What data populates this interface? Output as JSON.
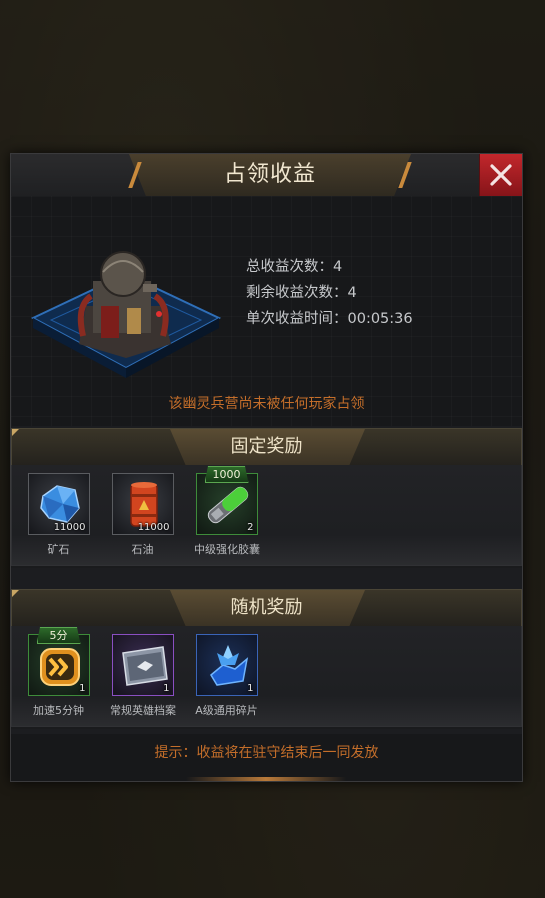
{
  "dialog": {
    "title": "占领收益",
    "close_icon": "close-icon"
  },
  "info": {
    "building_icon": "barracks-building-icon",
    "total_label": "总收益次数：",
    "total_value": "4",
    "remaining_label": "剩余收益次数：",
    "remaining_value": "4",
    "time_label": "单次收益时间：",
    "time_value": "00:05:36",
    "notice": "该幽灵兵营尚未被任何玩家占领"
  },
  "fixed_rewards": {
    "header": "固定奖励",
    "items": [
      {
        "label": "矿石",
        "qty": "11000",
        "badge": "",
        "icon": "ore-crystal-icon",
        "rarity": "gray"
      },
      {
        "label": "石油",
        "qty": "11000",
        "badge": "",
        "icon": "oil-barrel-icon",
        "rarity": "gray"
      },
      {
        "label": "中级强化胶囊",
        "qty": "2",
        "badge": "1000",
        "icon": "enhance-capsule-icon",
        "rarity": "green"
      }
    ]
  },
  "random_rewards": {
    "header": "随机奖励",
    "items": [
      {
        "label": "加速5分钟",
        "qty": "1",
        "badge": "5分",
        "icon": "speedup-icon",
        "rarity": "green"
      },
      {
        "label": "常规英雄档案",
        "qty": "1",
        "badge": "",
        "icon": "hero-file-icon",
        "rarity": "purple"
      },
      {
        "label": "A级通用碎片",
        "qty": "1",
        "badge": "",
        "icon": "shard-icon",
        "rarity": "blue"
      }
    ]
  },
  "footer": {
    "hint": "提示：收益将在驻守结束后一同发放"
  }
}
